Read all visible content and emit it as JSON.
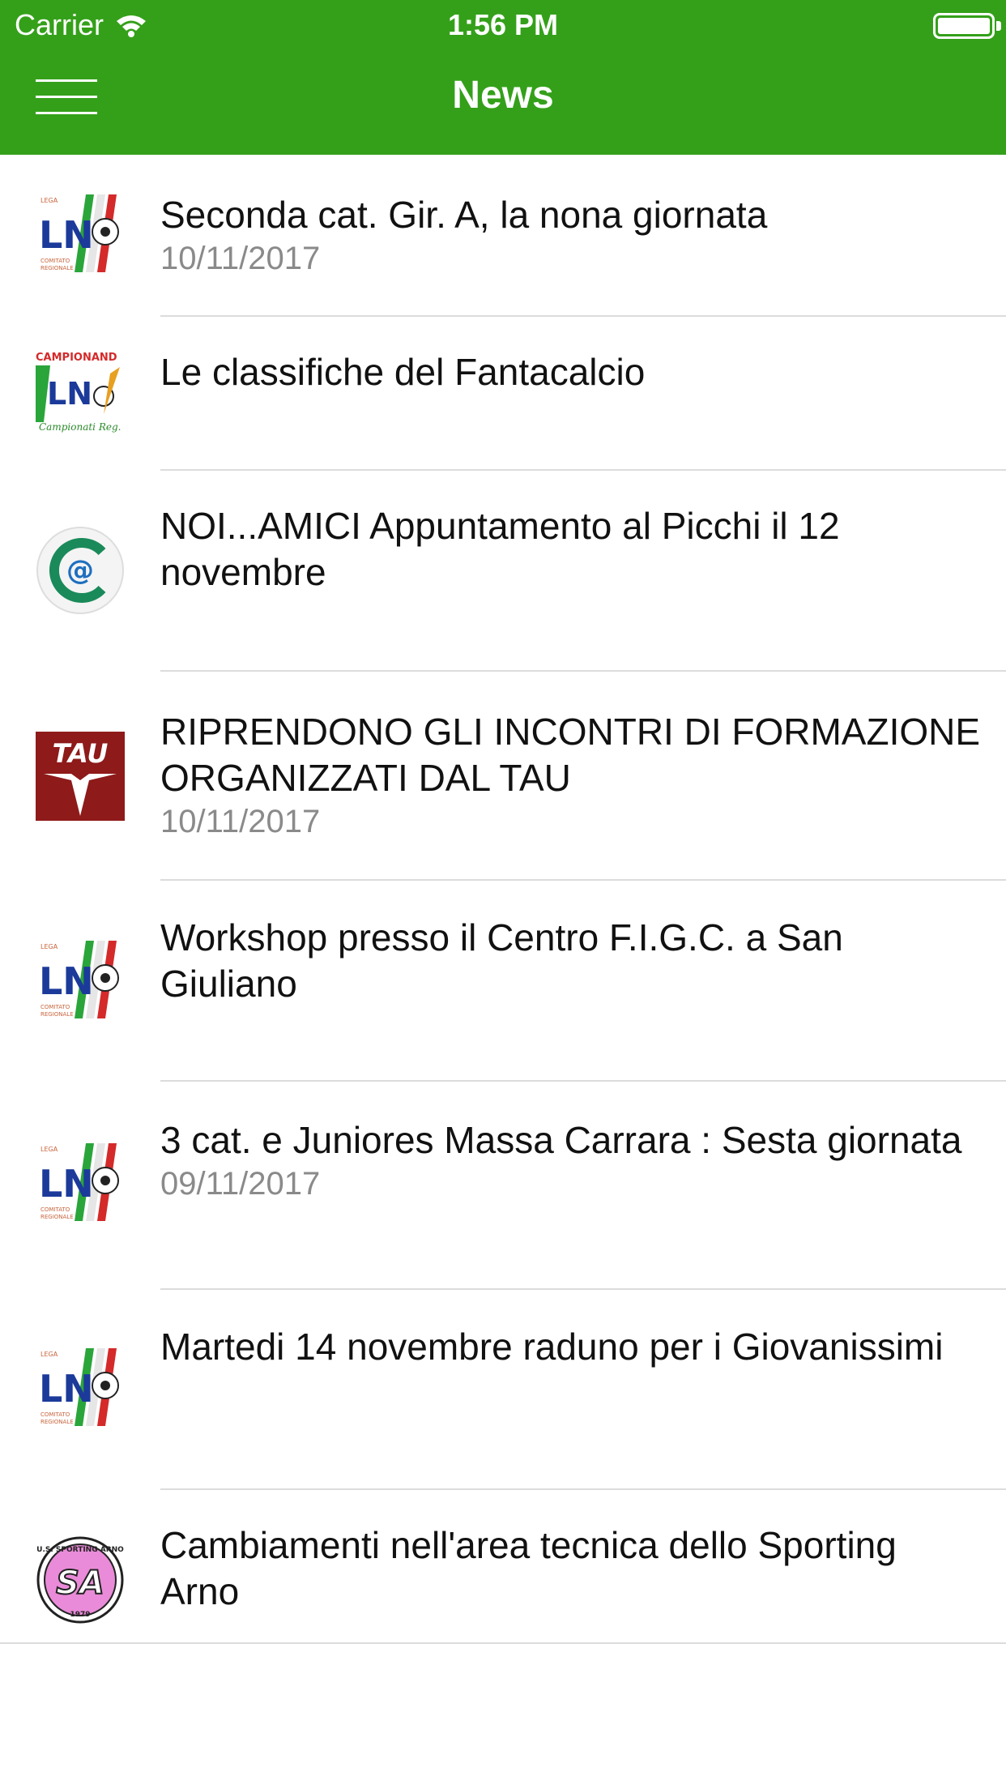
{
  "status_bar": {
    "carrier": "Carrier",
    "time": "1:56 PM"
  },
  "nav": {
    "title": "News",
    "menu_icon": "hamburger-menu-icon"
  },
  "colors": {
    "header": "#34a01a",
    "date_text": "#8a8a8a",
    "separator": "#dcdcdc"
  },
  "news": [
    {
      "title": "Seconda cat. Gir. A, la nona giornata",
      "date": "10/11/2017",
      "logo": "lnd-logo-icon"
    },
    {
      "title": "Le classifiche del Fantacalcio",
      "date": "",
      "logo": "campionando-logo-icon"
    },
    {
      "title": "NOI...AMICI  Appuntamento al Picchi il 12 novembre",
      "date": "",
      "logo": "at-sign-logo-icon"
    },
    {
      "title": "RIPRENDONO GLI INCONTRI DI FORMAZIONE ORGANIZZATI DAL TAU",
      "date": "10/11/2017",
      "logo": "tau-logo-icon"
    },
    {
      "title": "Workshop presso il Centro F.I.G.C. a San Giuliano",
      "date": "",
      "logo": "lnd-logo-icon"
    },
    {
      "title": "3 cat. e Juniores Massa Carrara : Sesta giornata",
      "date": "09/11/2017",
      "logo": "lnd-logo-icon"
    },
    {
      "title": "Martedi 14 novembre raduno per i Giovanissimi",
      "date": "",
      "logo": "lnd-logo-icon"
    },
    {
      "title": "Cambiamenti nell'area tecnica dello Sporting Arno",
      "date": "",
      "logo": "sporting-arno-logo-icon"
    }
  ]
}
